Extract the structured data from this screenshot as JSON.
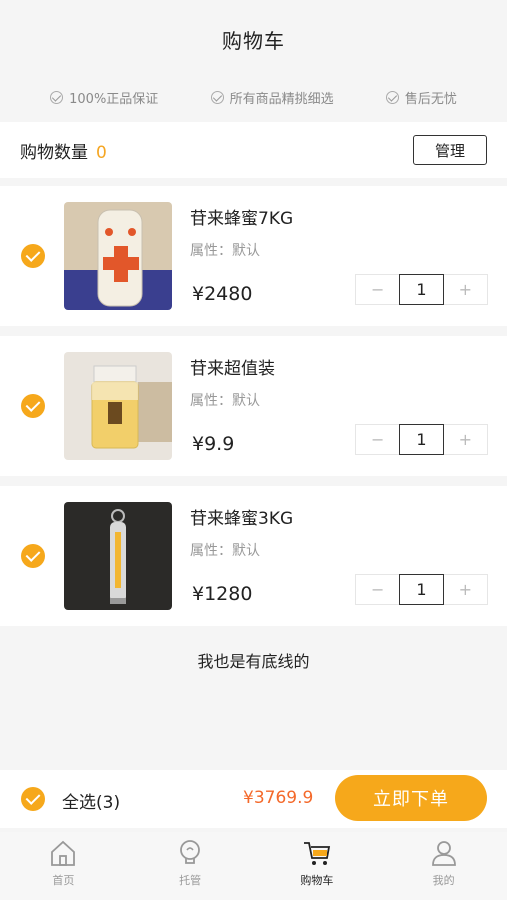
{
  "header": {
    "title": "购物车"
  },
  "guarantees": [
    "100%正品保证",
    "所有商品精挑细选",
    "售后无忧"
  ],
  "cart_summary": {
    "label": "购物数量",
    "count": "0",
    "manage_label": "管理"
  },
  "items": [
    {
      "name": "苷来蜂蜜7KG",
      "attr": "属性：默认",
      "price": "¥2480",
      "qty": "1",
      "minus": "−",
      "plus": "+"
    },
    {
      "name": "苷来超值装",
      "attr": "属性：默认",
      "price": "¥9.9",
      "qty": "1",
      "minus": "−",
      "plus": "+"
    },
    {
      "name": "苷来蜂蜜3KG",
      "attr": "属性：默认",
      "price": "¥1280",
      "qty": "1",
      "minus": "−",
      "plus": "+"
    }
  ],
  "footer_note": "我也是有底线的",
  "checkout": {
    "select_all_label": "全选(3)",
    "total": "¥3769.9",
    "order_label": "立即下单"
  },
  "tabs": [
    {
      "label": "首页",
      "icon": "home-icon"
    },
    {
      "label": "托管",
      "icon": "bulb-icon"
    },
    {
      "label": "购物车",
      "icon": "cart-icon"
    },
    {
      "label": "我的",
      "icon": "user-icon"
    }
  ],
  "colors": {
    "accent": "#f6a81b",
    "price_total": "#f4692a"
  }
}
